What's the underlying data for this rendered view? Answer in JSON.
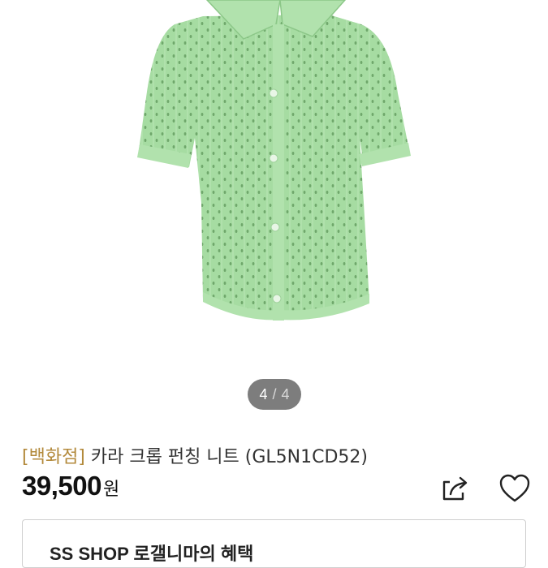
{
  "product_image": {
    "alt": "",
    "garment_color": "#a6dca2"
  },
  "pager": {
    "current": "4",
    "separator": "/",
    "total": "4"
  },
  "product": {
    "brand_tag": "[백화점]",
    "name": "카라 크롭 펀칭 니트 (GL5N1CD52)",
    "price": "39,500",
    "currency": "원"
  },
  "actions": {
    "share_icon": "share-icon",
    "wishlist_icon": "heart-icon"
  },
  "benefit": {
    "label": "SS SHOP 로갤니마의 혜택"
  },
  "colors": {
    "brand_tag": "#b38a3c",
    "pager_bg": "#7d7d7d"
  }
}
